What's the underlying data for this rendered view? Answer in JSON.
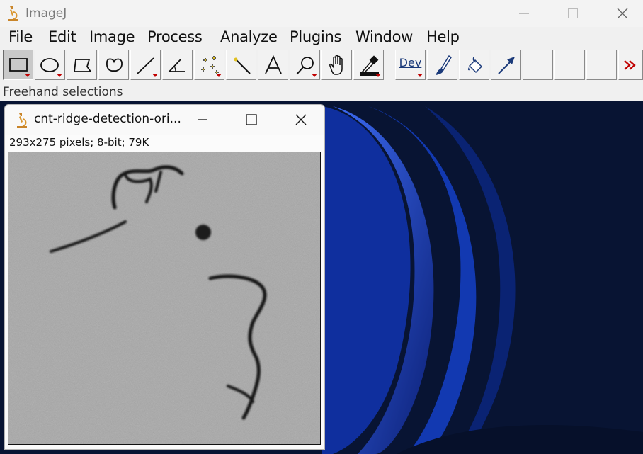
{
  "app": {
    "title": "ImageJ"
  },
  "menu": [
    "File",
    "Edit",
    "Image",
    "Process",
    "Analyze",
    "Plugins",
    "Window",
    "Help"
  ],
  "toolbar": {
    "tools": [
      {
        "name": "rectangle-tool",
        "icon": "rectangle-icon",
        "selected": true
      },
      {
        "name": "oval-tool",
        "icon": "oval-icon"
      },
      {
        "name": "polygon-tool",
        "icon": "polygon-icon"
      },
      {
        "name": "freehand-tool",
        "icon": "freehand-icon"
      },
      {
        "name": "straight-line-tool",
        "icon": "line-icon"
      },
      {
        "name": "angle-tool",
        "icon": "angle-icon"
      },
      {
        "name": "multi-point-tool",
        "icon": "multipoint-icon"
      },
      {
        "name": "wand-tool",
        "icon": "wand-icon"
      },
      {
        "name": "text-tool",
        "icon": "text-icon"
      },
      {
        "name": "zoom-tool",
        "icon": "magnifier-icon"
      },
      {
        "name": "hand-tool",
        "icon": "hand-icon"
      },
      {
        "name": "color-picker-tool",
        "icon": "dropper-icon"
      },
      {
        "name": "dev-tool",
        "icon": "dev-icon"
      },
      {
        "name": "brush-tool",
        "icon": "brush-icon"
      },
      {
        "name": "flood-fill-tool",
        "icon": "bucket-icon"
      },
      {
        "name": "arrow-tool",
        "icon": "arrow-icon"
      },
      {
        "name": "empty-slot-1",
        "icon": ""
      },
      {
        "name": "empty-slot-2",
        "icon": ""
      },
      {
        "name": "empty-slot-3",
        "icon": ""
      },
      {
        "name": "more-tools",
        "icon": "double-chevron-icon"
      }
    ],
    "dev_label": "Dev"
  },
  "status": "Freehand selections",
  "image_window": {
    "title": "cnt-ridge-detection-ori...",
    "info": "293x275 pixels; 8-bit; 79K"
  },
  "colors": {
    "accent": "#1b3a7a",
    "dropdown_triangle": "#c00000",
    "more_chevrons": "#c00000"
  }
}
